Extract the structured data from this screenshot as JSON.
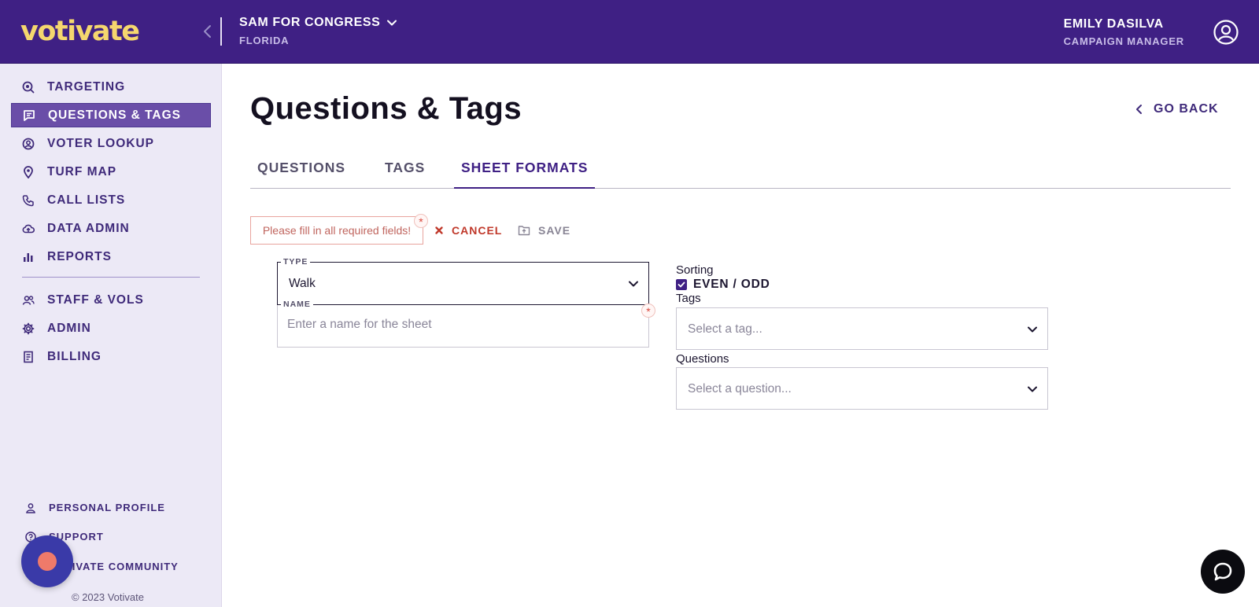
{
  "header": {
    "logo_text": "votivate",
    "campaign_name": "SAM FOR CONGRESS",
    "campaign_state": "FLORIDA",
    "user_name": "EMILY DASILVA",
    "user_role": "CAMPAIGN MANAGER",
    "background_color": "#3f2084"
  },
  "sidebar": {
    "items": [
      {
        "label": "TARGETING",
        "icon": "targeting-icon"
      },
      {
        "label": "QUESTIONS & TAGS",
        "icon": "chat-icon",
        "active": true
      },
      {
        "label": "VOTER LOOKUP",
        "icon": "user-circle-icon"
      },
      {
        "label": "TURF MAP",
        "icon": "map-pin-icon"
      },
      {
        "label": "CALL LISTS",
        "icon": "phone-icon"
      },
      {
        "label": "DATA ADMIN",
        "icon": "cloud-upload-icon"
      },
      {
        "label": "REPORTS",
        "icon": "bar-chart-icon"
      },
      {
        "label": "STAFF & VOLS",
        "icon": "users-icon"
      },
      {
        "label": "ADMIN",
        "icon": "gear-icon"
      },
      {
        "label": "BILLING",
        "icon": "receipt-icon"
      }
    ],
    "footer_items": [
      {
        "label": "PERSONAL PROFILE",
        "icon": "person-icon"
      },
      {
        "label": "SUPPORT",
        "icon": "help-icon"
      },
      {
        "label": "VOTIVATE COMMUNITY",
        "icon": "community-icon"
      }
    ],
    "copyright": "© 2023 Votivate"
  },
  "main": {
    "title": "Questions & Tags",
    "go_back": "GO BACK",
    "tabs": [
      {
        "label": "QUESTIONS"
      },
      {
        "label": "TAGS"
      },
      {
        "label": "SHEET FORMATS",
        "active": true
      }
    ],
    "error_message": "Please fill in all required fields!",
    "required_marker": "*",
    "cancel_label": "CANCEL",
    "save_label": "SAVE",
    "form": {
      "type_label": "TYPE",
      "type_value": "Walk",
      "name_label": "NAME",
      "name_placeholder": "Enter a name for the sheet",
      "sorting_label": "Sorting",
      "even_odd_label": "EVEN / ODD",
      "even_odd_checked": true,
      "tags_label": "Tags",
      "tags_placeholder": "Select a tag...",
      "questions_label": "Questions",
      "questions_placeholder": "Select a question..."
    }
  },
  "colors": {
    "accent": "#3f2084",
    "active_nav": "#6a4ea8",
    "error": "#c0392b"
  }
}
